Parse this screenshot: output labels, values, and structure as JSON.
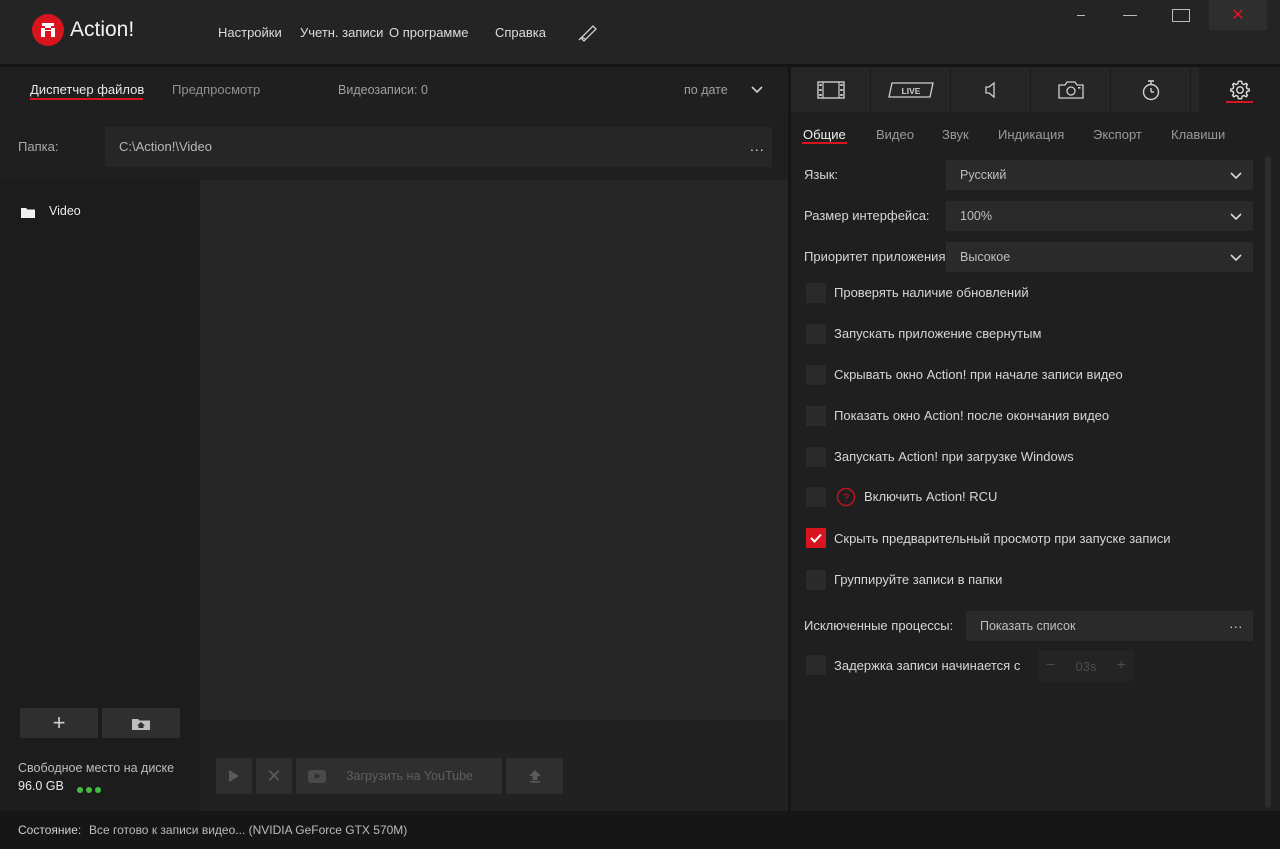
{
  "app": {
    "title": "Action!"
  },
  "menu": [
    "Настройки",
    "Учетн. записи",
    "О программе",
    "Справка"
  ],
  "window": {
    "close_glyph": "✕"
  },
  "left": {
    "tabs": [
      "Диспетчер файлов",
      "Предпросмотр"
    ],
    "video_count": "Видеозаписи: 0",
    "sort": "по дате",
    "folder_label": "Папка:",
    "folder_path": "C:\\Action!\\Video",
    "folder_more": "...",
    "tree": [
      {
        "label": "Video"
      }
    ],
    "add_glyph": "+",
    "disk_label": "Свободное место на диске",
    "disk_value": "96.0 GB",
    "buttons": {
      "delete_glyph": "✕",
      "youtube": "Загрузить на YouTube"
    }
  },
  "right": {
    "icon_tabs": [
      "film-icon",
      "live-icon",
      "sound-icon",
      "camera-icon",
      "timer-icon",
      "gear-icon"
    ],
    "live_label": "LIVE",
    "subtabs": [
      "Общие",
      "Видео",
      "Звук",
      "Индикация",
      "Экспорт",
      "Клавиши"
    ],
    "language": {
      "label": "Язык:",
      "value": "Русский"
    },
    "ui_size": {
      "label": "Размер интерфейса:",
      "value": "100%"
    },
    "priority": {
      "label": "Приоритет приложения",
      "value": "Высокое"
    },
    "checkboxes": [
      {
        "label": "Проверять наличие обновлений",
        "checked": false
      },
      {
        "label": "Запускать приложение свернутым",
        "checked": false
      },
      {
        "label": "Скрывать окно Action! при начале записи видео",
        "checked": false
      },
      {
        "label": "Показать окно Action! после окончания видео",
        "checked": false
      },
      {
        "label": "Запускать Action! при загрузке Windows",
        "checked": false
      },
      {
        "label": "Включить Action! RCU",
        "checked": false
      },
      {
        "label": "Скрыть предварительный просмотр при запуске записи",
        "checked": true
      },
      {
        "label": "Группируйте записи в папки",
        "checked": false
      }
    ],
    "rcu_help_glyph": "?",
    "excluded": {
      "label": "Исключенные процессы:",
      "value": "Показать список",
      "more": "..."
    },
    "delay": {
      "label": "Задержка записи начинается с",
      "value": "03s",
      "minus": "−",
      "plus": "+"
    }
  },
  "status": {
    "label": "Состояние:",
    "text": "Все готово к записи видео...  (NVIDIA GeForce GTX 570M)"
  },
  "colors": {
    "accent": "#d8141e",
    "background": "#1f1f1f",
    "disk_ok": "#3fbf3f"
  }
}
